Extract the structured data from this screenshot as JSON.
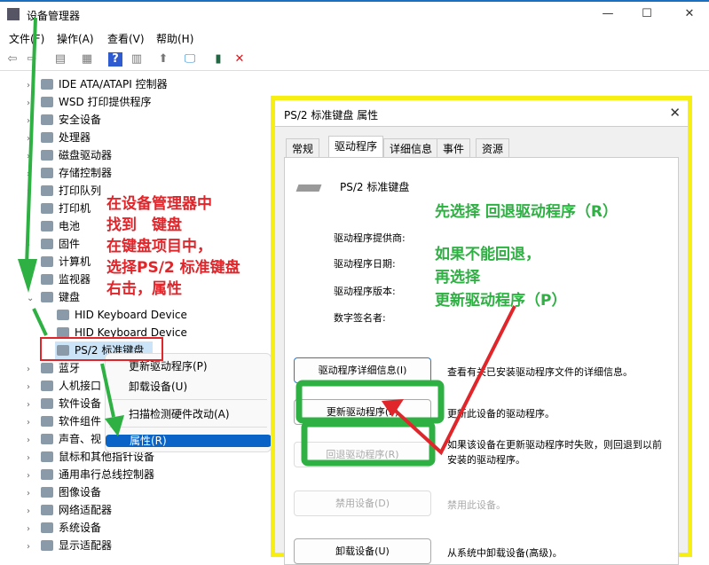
{
  "window": {
    "title": "设备管理器",
    "minimize": "—",
    "maximize": "☐",
    "close": "✕"
  },
  "menu": [
    "文件(F)",
    "操作(A)",
    "查看(V)",
    "帮助(H)"
  ],
  "tree": [
    {
      "label": "IDE ATA/ATAPI 控制器",
      "chev": "›"
    },
    {
      "label": "WSD 打印提供程序",
      "chev": "›"
    },
    {
      "label": "安全设备",
      "chev": "›"
    },
    {
      "label": "处理器",
      "chev": "›"
    },
    {
      "label": "磁盘驱动器",
      "chev": "›"
    },
    {
      "label": "存储控制器",
      "chev": "›"
    },
    {
      "label": "打印队列",
      "chev": "›"
    },
    {
      "label": "打印机",
      "chev": "›"
    },
    {
      "label": "电池",
      "chev": "›"
    },
    {
      "label": "固件",
      "chev": "›"
    },
    {
      "label": "计算机",
      "chev": "›"
    },
    {
      "label": "监视器",
      "chev": "›"
    },
    {
      "label": "键盘",
      "chev": "⌄"
    },
    {
      "label": "HID Keyboard Device",
      "chev": ""
    },
    {
      "label": "HID Keyboard Device",
      "chev": ""
    },
    {
      "label": "PS/2 标准键盘",
      "chev": ""
    },
    {
      "label": "蓝牙",
      "chev": "›"
    },
    {
      "label": "人机接口",
      "chev": "›"
    },
    {
      "label": "软件设备",
      "chev": "›"
    },
    {
      "label": "软件组件",
      "chev": "›"
    },
    {
      "label": "声音、视",
      "chev": "›"
    },
    {
      "label": "鼠标和其他指针设备",
      "chev": "›"
    },
    {
      "label": "通用串行总线控制器",
      "chev": "›"
    },
    {
      "label": "图像设备",
      "chev": "›"
    },
    {
      "label": "网络适配器",
      "chev": "›"
    },
    {
      "label": "系统设备",
      "chev": "›"
    },
    {
      "label": "显示适配器",
      "chev": "›"
    }
  ],
  "context_menu": {
    "update": "更新驱动程序(P)",
    "uninstall": "卸载设备(U)",
    "scan": "扫描检测硬件改动(A)",
    "properties": "属性(R)"
  },
  "dialog": {
    "title": "PS/2 标准键盘 属性",
    "close": "✕",
    "tabs": [
      "常规",
      "驱动程序",
      "详细信息",
      "事件",
      "资源"
    ],
    "device_name": "PS/2 标准键盘",
    "fields": [
      "驱动程序提供商:",
      "驱动程序日期:",
      "驱动程序版本:",
      "数字签名者:"
    ],
    "buttons": [
      {
        "label": "驱动程序详细信息(I)",
        "desc": "查看有关已安装驱动程序文件的详细信息。"
      },
      {
        "label": "更新驱动程序(P)",
        "desc": "更新此设备的驱动程序。"
      },
      {
        "label": "回退驱动程序(R)",
        "desc": "如果该设备在更新驱动程序时失败，则回退到以前安装的驱动程序。"
      },
      {
        "label": "禁用设备(D)",
        "desc": "禁用此设备。"
      },
      {
        "label": "卸载设备(U)",
        "desc": "从系统中卸载设备(高级)。"
      }
    ]
  },
  "annotations": {
    "red": [
      "在设备管理器中",
      "找到　键盘",
      "在键盘项目中，",
      "选择PS/2 标准键盘",
      "右击，属性"
    ],
    "green1": "先选择 回退驱动程序（R）",
    "green2": [
      "如果不能回退，",
      "再选择",
      "更新驱动程序（P）"
    ]
  },
  "colors": {
    "accent": "#0a64c8",
    "annotation_green": "#2eb043",
    "annotation_red": "#e0262b",
    "highlight_yellow": "#f7ef12"
  }
}
